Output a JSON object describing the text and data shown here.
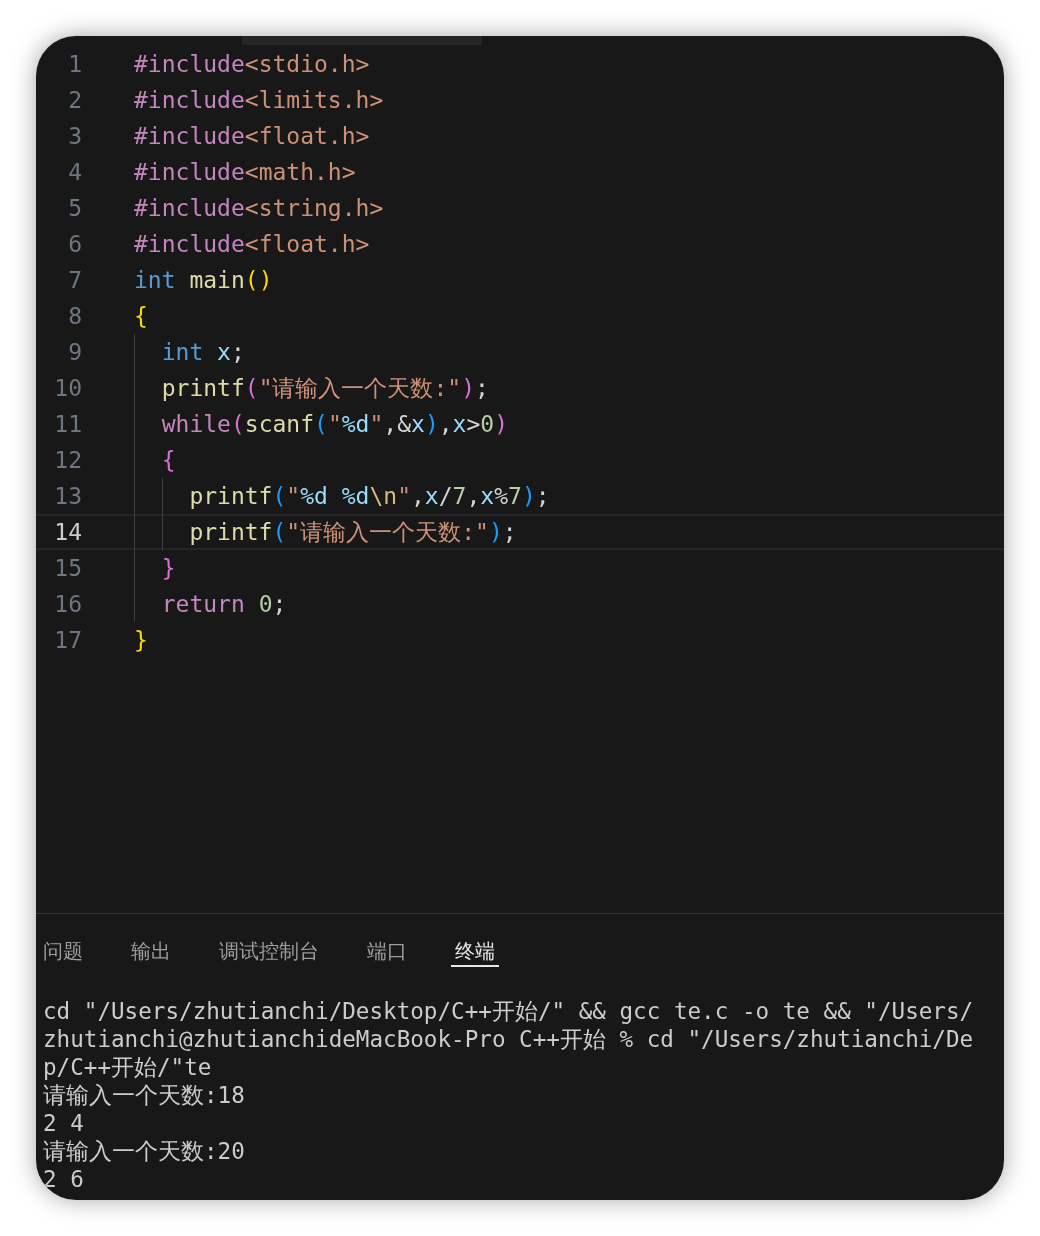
{
  "editor": {
    "lines": [
      {
        "number": "1",
        "selected": false,
        "tokens": [
          {
            "kind": "directive",
            "text": "#include"
          },
          {
            "kind": "header",
            "text": "<stdio.h>"
          }
        ]
      },
      {
        "number": "2",
        "selected": false,
        "tokens": [
          {
            "kind": "directive",
            "text": "#include"
          },
          {
            "kind": "header",
            "text": "<limits.h>"
          }
        ]
      },
      {
        "number": "3",
        "selected": false,
        "tokens": [
          {
            "kind": "directive",
            "text": "#include"
          },
          {
            "kind": "header",
            "text": "<float.h>"
          }
        ]
      },
      {
        "number": "4",
        "selected": false,
        "tokens": [
          {
            "kind": "directive",
            "text": "#include"
          },
          {
            "kind": "header",
            "text": "<math.h>"
          }
        ]
      },
      {
        "number": "5",
        "selected": false,
        "tokens": [
          {
            "kind": "directive",
            "text": "#include"
          },
          {
            "kind": "header",
            "text": "<string.h>"
          }
        ]
      },
      {
        "number": "6",
        "selected": false,
        "tokens": [
          {
            "kind": "directive",
            "text": "#include"
          },
          {
            "kind": "header",
            "text": "<float.h>"
          }
        ]
      },
      {
        "number": "7",
        "selected": false,
        "tokens": [
          {
            "kind": "type",
            "text": "int "
          },
          {
            "kind": "function",
            "text": "main"
          },
          {
            "kind": "bracket1",
            "text": "()"
          }
        ]
      },
      {
        "number": "8",
        "selected": false,
        "tokens": [
          {
            "kind": "bracket1",
            "text": "{"
          }
        ],
        "children": [
          {
            "number": "9",
            "selected": false,
            "tokens": [
              {
                "kind": "type",
                "text": "int "
              },
              {
                "kind": "variable",
                "text": "x"
              },
              {
                "kind": "plain",
                "text": ";"
              }
            ]
          },
          {
            "number": "10",
            "selected": false,
            "tokens": [
              {
                "kind": "function",
                "text": "printf"
              },
              {
                "kind": "bracket2",
                "text": "("
              },
              {
                "kind": "string",
                "text": "\"请输入一个天数:\""
              },
              {
                "kind": "bracket2",
                "text": ")"
              },
              {
                "kind": "plain",
                "text": ";"
              }
            ]
          },
          {
            "number": "11",
            "selected": false,
            "tokens": [
              {
                "kind": "control",
                "text": "while"
              },
              {
                "kind": "bracket2",
                "text": "("
              },
              {
                "kind": "function",
                "text": "scanf"
              },
              {
                "kind": "bracket3",
                "text": "("
              },
              {
                "kind": "string",
                "text": "\""
              },
              {
                "kind": "format",
                "text": "%d"
              },
              {
                "kind": "string",
                "text": "\""
              },
              {
                "kind": "plain",
                "text": ",&"
              },
              {
                "kind": "variable",
                "text": "x"
              },
              {
                "kind": "bracket3",
                "text": ")"
              },
              {
                "kind": "plain",
                "text": ","
              },
              {
                "kind": "variable",
                "text": "x"
              },
              {
                "kind": "plain",
                "text": ">"
              },
              {
                "kind": "number",
                "text": "0"
              },
              {
                "kind": "bracket2",
                "text": ")"
              }
            ]
          },
          {
            "number": "12",
            "selected": false,
            "tokens": [
              {
                "kind": "bracket2",
                "text": "{"
              }
            ],
            "children": [
              {
                "number": "13",
                "selected": false,
                "tokens": [
                  {
                    "kind": "function",
                    "text": "printf"
                  },
                  {
                    "kind": "bracket3",
                    "text": "("
                  },
                  {
                    "kind": "string",
                    "text": "\""
                  },
                  {
                    "kind": "format",
                    "text": "%d %d"
                  },
                  {
                    "kind": "escape",
                    "text": "\\n"
                  },
                  {
                    "kind": "string",
                    "text": "\""
                  },
                  {
                    "kind": "plain",
                    "text": ","
                  },
                  {
                    "kind": "variable",
                    "text": "x"
                  },
                  {
                    "kind": "plain",
                    "text": "/"
                  },
                  {
                    "kind": "number",
                    "text": "7"
                  },
                  {
                    "kind": "plain",
                    "text": ","
                  },
                  {
                    "kind": "variable",
                    "text": "x"
                  },
                  {
                    "kind": "plain",
                    "text": "%"
                  },
                  {
                    "kind": "number",
                    "text": "7"
                  },
                  {
                    "kind": "bracket3",
                    "text": ")"
                  },
                  {
                    "kind": "plain",
                    "text": ";"
                  }
                ]
              },
              {
                "number": "14",
                "selected": true,
                "tokens": [
                  {
                    "kind": "function",
                    "text": "printf"
                  },
                  {
                    "kind": "bracket3",
                    "text": "("
                  },
                  {
                    "kind": "string",
                    "text": "\"请输入一个天数:\""
                  },
                  {
                    "kind": "bracket3",
                    "text": ")"
                  },
                  {
                    "kind": "plain",
                    "text": ";"
                  }
                ]
              }
            ]
          },
          {
            "number": "15",
            "selected": false,
            "tokens": [
              {
                "kind": "bracket2",
                "text": "}"
              }
            ]
          },
          {
            "number": "16",
            "selected": false,
            "tokens": [
              {
                "kind": "control",
                "text": "return "
              },
              {
                "kind": "number",
                "text": "0"
              },
              {
                "kind": "plain",
                "text": ";"
              }
            ]
          }
        ]
      },
      {
        "number": "17",
        "selected": false,
        "tokens": [
          {
            "kind": "bracket1",
            "text": "}"
          }
        ]
      }
    ]
  },
  "panel": {
    "tabs": [
      {
        "label": "问题",
        "selected": false
      },
      {
        "label": "输出",
        "selected": false
      },
      {
        "label": "调试控制台",
        "selected": false
      },
      {
        "label": "端口",
        "selected": false
      },
      {
        "label": "终端",
        "selected": true
      }
    ]
  },
  "terminal": {
    "lines": [
      "cd \"/Users/zhutianchi/Desktop/C++开始/\" && gcc te.c -o te && \"/Users/",
      "zhutianchi@zhutianchideMacBook-Pro C++开始 % cd \"/Users/zhutianchi/De",
      "p/C++开始/\"te",
      "请输入一个天数:18",
      "2 4",
      "请输入一个天数:20",
      "2 6"
    ]
  }
}
